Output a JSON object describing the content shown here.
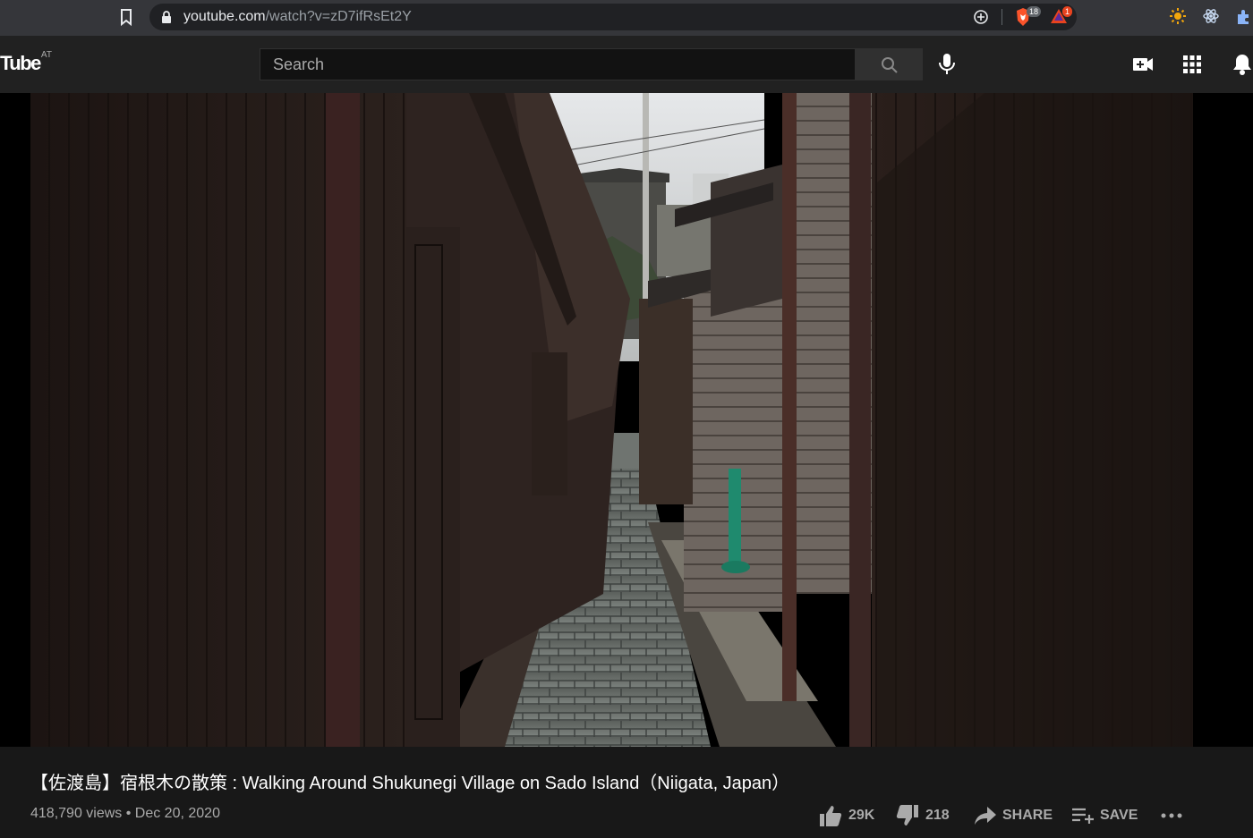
{
  "browser": {
    "url_host": "youtube.com",
    "url_path": "/watch?v=zD7ifRsEt2Y",
    "brave_shields_count": "18",
    "rewards_count": "1",
    "extensions": [
      "sun-icon",
      "atom-icon",
      "puzzle-icon"
    ]
  },
  "masthead": {
    "logo_text": "Tube",
    "country_code": "AT",
    "search_placeholder": "Search"
  },
  "video": {
    "scene": "narrow-stone-alley",
    "title": "【佐渡島】宿根木の散策 : Walking Around Shukunegi Village on Sado Island（Niigata, Japan）",
    "views_date": "418,790 views • Dec 20, 2020"
  },
  "actions": {
    "like_count": "29K",
    "dislike_count": "218",
    "share_label": "SHARE",
    "save_label": "SAVE"
  },
  "colors": {
    "background": "#181818",
    "masthead": "#212121",
    "browser_toolbar": "#35363a",
    "brave_orange": "#fb542b",
    "secondary_text": "#aaaaaa"
  }
}
